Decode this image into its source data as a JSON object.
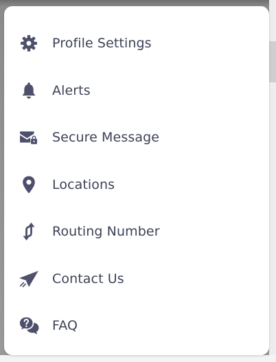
{
  "theme": {
    "icon_color": "#4d4f6b",
    "text_color": "#3d4156"
  },
  "menu": {
    "items": [
      {
        "label": "Profile Settings",
        "icon": "gear-icon"
      },
      {
        "label": "Alerts",
        "icon": "bell-icon"
      },
      {
        "label": "Secure Message",
        "icon": "secure-mail-icon"
      },
      {
        "label": "Locations",
        "icon": "map-pin-icon"
      },
      {
        "label": "Routing Number",
        "icon": "swap-arrows-icon"
      },
      {
        "label": "Contact Us",
        "icon": "paper-plane-icon"
      },
      {
        "label": "FAQ",
        "icon": "question-chat-icon"
      }
    ]
  }
}
